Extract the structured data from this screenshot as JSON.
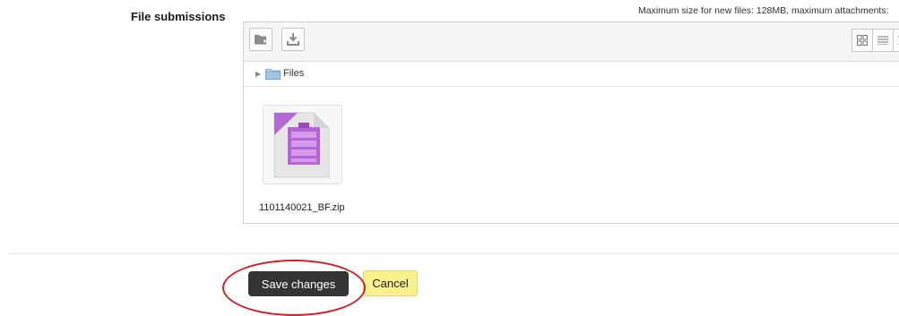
{
  "form": {
    "field_label": "File submissions",
    "max_info": "Maximum size for new files: 128MB, maximum attachments:"
  },
  "filemanager": {
    "toolbar": {
      "add_icon": "add-file-icon",
      "download_icon": "download-icon",
      "view_icons": [
        "grid-view-icon",
        "list-view-icon",
        "tree-view-icon"
      ]
    },
    "path": {
      "label": "Files",
      "folder_icon": "folder-icon"
    },
    "files": [
      {
        "name": "1101140021_BF.zip",
        "icon": "zip-archive-icon",
        "accent": "#a855c8"
      }
    ]
  },
  "actions": {
    "save_label": "Save changes",
    "cancel_label": "Cancel"
  },
  "colors": {
    "save_bg": "#343434",
    "cancel_bg": "#f7f28b",
    "annotation": "#d0222a"
  }
}
